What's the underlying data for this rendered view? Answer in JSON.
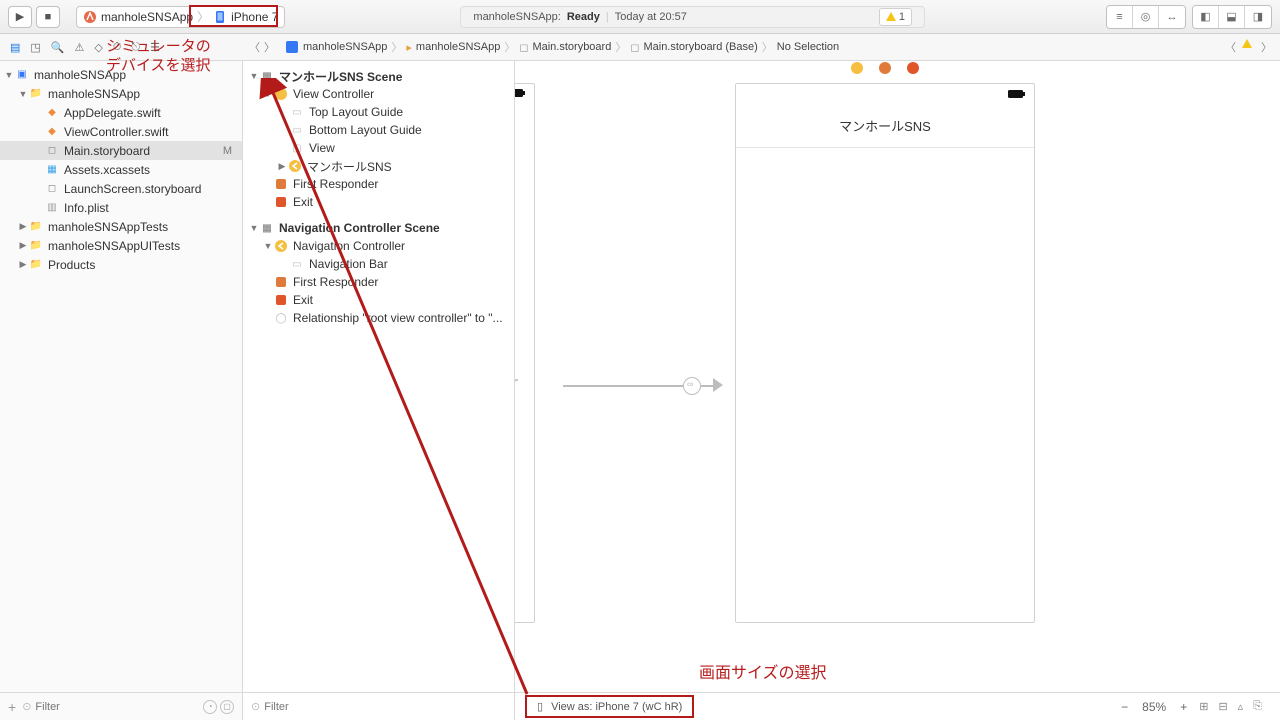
{
  "toolbar": {
    "scheme_app": "manholeSNSApp",
    "scheme_device": "iPhone 7",
    "status_app": "manholeSNSApp:",
    "status_state": "Ready",
    "status_time": "Today at 20:57",
    "issue_count": "1"
  },
  "breadcrumb": {
    "seg1": "manholeSNSApp",
    "seg2": "manholeSNSApp",
    "seg3": "Main.storyboard",
    "seg4": "Main.storyboard (Base)",
    "seg5": "No Selection"
  },
  "navigator": {
    "root": "manholeSNSApp",
    "group": "manholeSNSApp",
    "files": {
      "f1": "AppDelegate.swift",
      "f2": "ViewController.swift",
      "f3": "Main.storyboard",
      "f3_badge": "M",
      "f4": "Assets.xcassets",
      "f5": "LaunchScreen.storyboard",
      "f6": "Info.plist"
    },
    "group2": "manholeSNSAppTests",
    "group3": "manholeSNSAppUITests",
    "group4": "Products"
  },
  "outline": {
    "scene1": "マンホールSNS Scene",
    "s1": {
      "vc": "View Controller",
      "tlg": "Top Layout Guide",
      "blg": "Bottom Layout Guide",
      "view": "View",
      "navitem": "マンホールSNS",
      "fr": "First Responder",
      "exit": "Exit"
    },
    "scene2": "Navigation Controller Scene",
    "s2": {
      "nc": "Navigation Controller",
      "nb": "Navigation Bar",
      "fr": "First Responder",
      "exit": "Exit",
      "rel": "Relationship \"root view controller\" to \"..."
    }
  },
  "canvas": {
    "nav_title": "マンホールSNS",
    "view_as": "View as: iPhone 7 (wC hR)",
    "zoom": "85%"
  },
  "filters": {
    "nav_placeholder": "Filter",
    "outline_placeholder": "Filter"
  },
  "annotations": {
    "line1": "シミュレータの",
    "line2": "デバイスを選択",
    "bottom": "画面サイズの選択"
  }
}
